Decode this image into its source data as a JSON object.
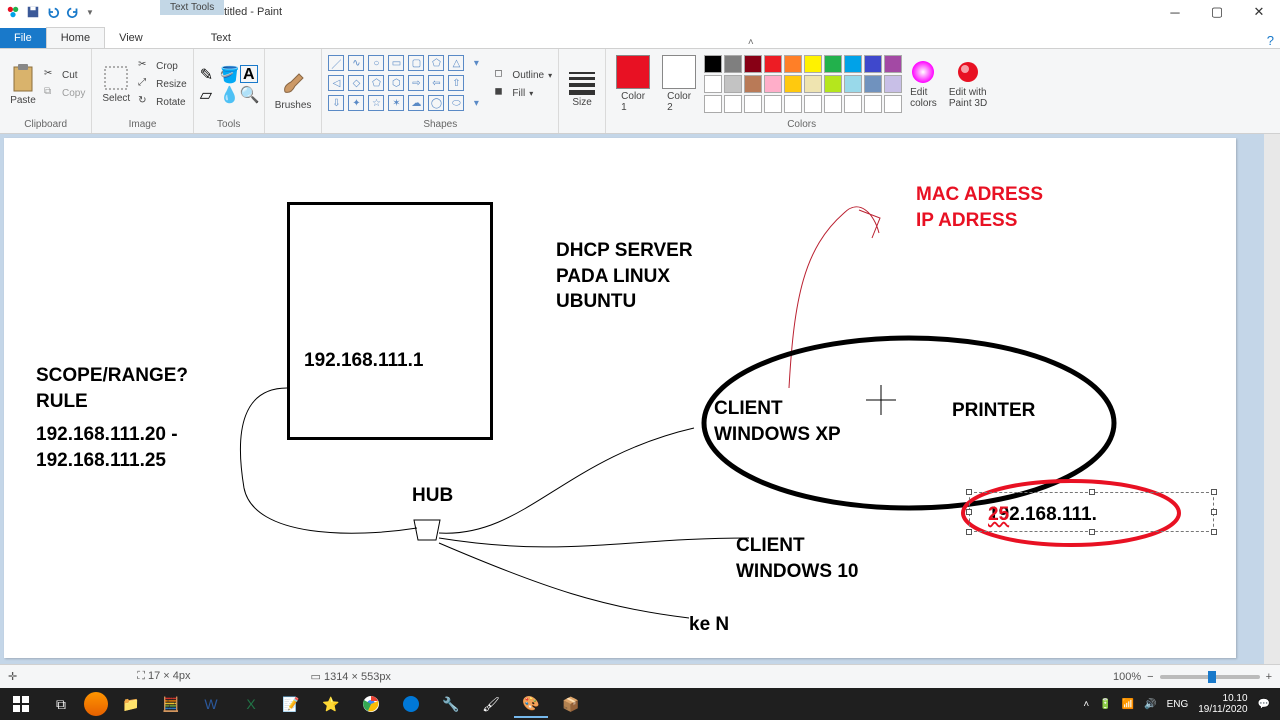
{
  "titlebar": {
    "title": "Untitled - Paint",
    "context_tab": "Text Tools"
  },
  "tabs": {
    "file": "File",
    "home": "Home",
    "view": "View",
    "text": "Text"
  },
  "ribbon": {
    "clipboard": {
      "paste": "Paste",
      "cut": "Cut",
      "copy": "Copy",
      "label": "Clipboard"
    },
    "image": {
      "select": "Select",
      "crop": "Crop",
      "resize": "Resize",
      "rotate": "Rotate",
      "label": "Image"
    },
    "tools": {
      "label": "Tools"
    },
    "brushes": {
      "label": "Brushes",
      "btn": "Brushes"
    },
    "shapes": {
      "label": "Shapes",
      "outline": "Outline",
      "fill": "Fill"
    },
    "size": {
      "label": "Size"
    },
    "colors": {
      "c1": "Color\n1",
      "c2": "Color\n2",
      "edit": "Edit\ncolors",
      "p3d": "Edit with\nPaint 3D",
      "label": "Colors"
    }
  },
  "canvas": {
    "scope_title": "SCOPE/RANGE?\nRULE",
    "scope_range": "192.168.111.20 -\n192.168.111.25",
    "server_ip": "192.168.111.1",
    "dhcp": "DHCP SERVER\nPADA LINUX\nUBUNTU",
    "hub": "HUB",
    "client_xp": "CLIENT\nWINDOWS XP",
    "printer": "PRINTER",
    "mac": "MAC ADRESS\nIP ADRESS",
    "printer_ip_a": "192.168.111. ",
    "printer_ip_b": "25",
    "client10": "CLIENT\nWINDOWS 10",
    "ken": "ke N"
  },
  "status": {
    "cursor": "",
    "sel": "17 × 4px",
    "canvas_size": "1314 × 553px",
    "zoom": "100%"
  },
  "tray": {
    "lang": "ENG",
    "time": "10.10",
    "date": "19/11/2020"
  },
  "palette_row1": [
    "#000",
    "#7f7f7f",
    "#880015",
    "#ed1c24",
    "#ff7f27",
    "#fff200",
    "#22b14c",
    "#00a2e8",
    "#3f48cc",
    "#a349a4"
  ],
  "palette_row2": [
    "#fff",
    "#c3c3c3",
    "#b97a57",
    "#ffaec9",
    "#ffc90e",
    "#efe4b0",
    "#b5e61d",
    "#99d9ea",
    "#7092be",
    "#c8bfe7"
  ]
}
